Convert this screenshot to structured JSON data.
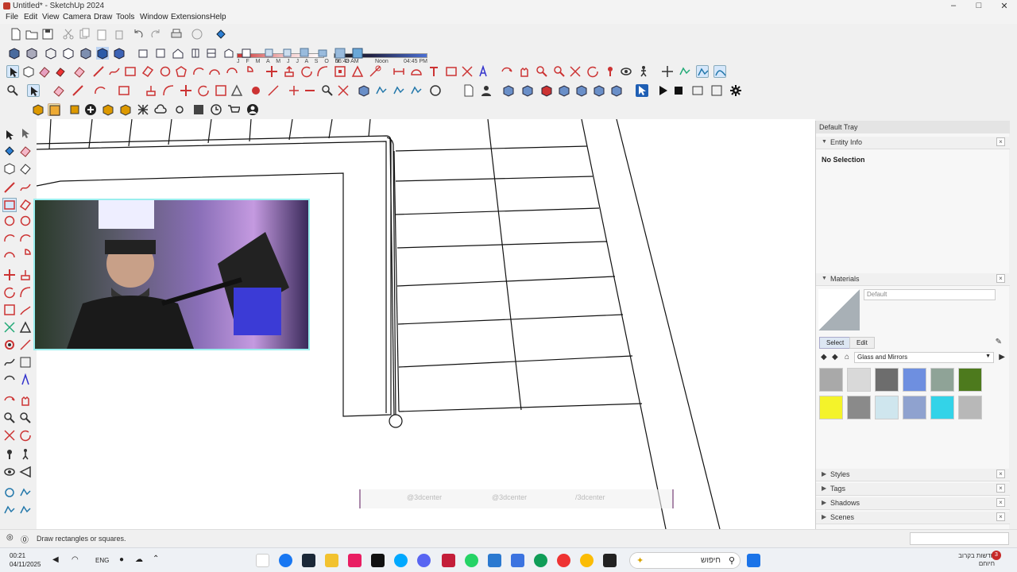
{
  "window": {
    "title": "Untitled* - SketchUp 2024",
    "controls": [
      "–",
      "□",
      "✕"
    ]
  },
  "menu": [
    "File",
    "Edit",
    "View",
    "Camera",
    "Draw",
    "Tools",
    "Window",
    "Extensions",
    "Help"
  ],
  "shadow_settings": {
    "months": "J F M A M J J A S O N D",
    "time_start": "06:43 AM",
    "time_noon": "Noon",
    "time_end": "04:45 PM"
  },
  "tray": {
    "title": "Default Tray",
    "entity_info": {
      "header": "Entity Info",
      "selection": "No Selection"
    },
    "materials": {
      "header": "Materials",
      "material_name": "Default",
      "tabs": [
        "Select",
        "Edit"
      ],
      "library": "Glass and Mirrors",
      "swatch_colors": [
        "#a9a9a9",
        "#d9d9d9",
        "#6d6d6d",
        "#6e8fe0",
        "#8fa397",
        "#4d7a1d",
        "#f4f32a",
        "#8a8a8a",
        "#cfe6ee",
        "#8fa2cf",
        "#33d3e8",
        "#b8b8b8"
      ]
    },
    "collapsed_panels": [
      "Styles",
      "Tags",
      "Shadows",
      "Scenes"
    ]
  },
  "status": {
    "message": "Draw rectangles or squares."
  },
  "taskbar": {
    "time": "00:21",
    "date": "04/11/2025",
    "language": "ENG",
    "search_label": "חיפוש",
    "news_line1": "חדשות בקרוב",
    "news_line2": "חיוחם",
    "news_badge": "3"
  },
  "overlay": {
    "social1": "@3dcenter",
    "social2": "@3dcenter",
    "social3": "/3dcenter"
  },
  "colors": {
    "accent": "#1a73e8",
    "webcam_border": "#9eeeee"
  }
}
